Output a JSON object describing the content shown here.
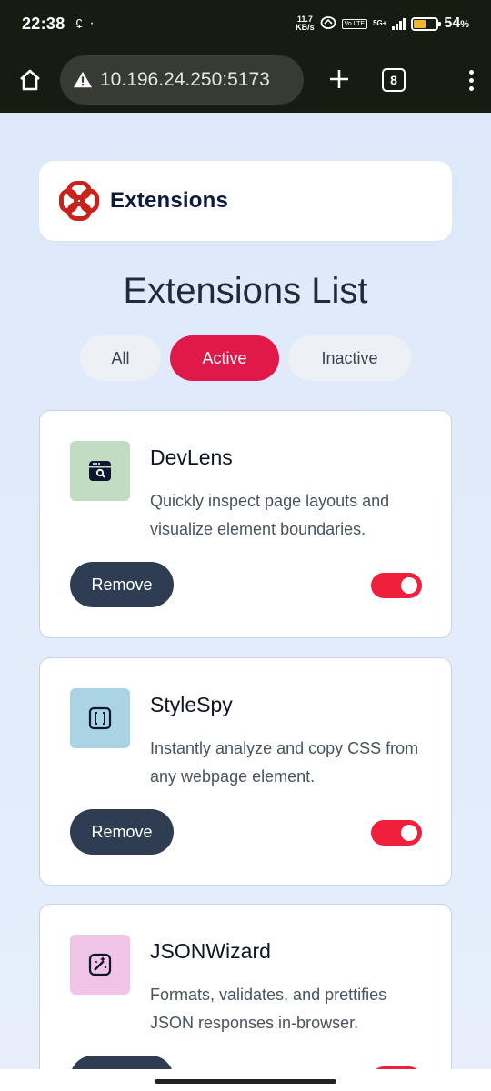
{
  "status_bar": {
    "time": "22:38",
    "net_speed_value": "11.7",
    "net_speed_unit": "KB/s",
    "network_type": "5G+",
    "volte_label": "Vo LTE",
    "battery_percent": "54",
    "battery_percent_suffix": "%",
    "battery_level": 0.54,
    "battery_color": "#f3b52c"
  },
  "browser": {
    "url": "10.196.24.250:5173",
    "tab_count": "8",
    "icons": [
      "home-icon",
      "warning-icon",
      "plus-icon",
      "tabs-icon",
      "more-vert-icon"
    ]
  },
  "header": {
    "brand": "Extensions",
    "logo_color": "#c7231c"
  },
  "page": {
    "title": "Extensions List"
  },
  "filters": [
    {
      "label": "All",
      "selected": false
    },
    {
      "label": "Active",
      "selected": true
    },
    {
      "label": "Inactive",
      "selected": false
    }
  ],
  "accent_color": "#e0194a",
  "extensions": [
    {
      "name": "DevLens",
      "description": "Quickly inspect page layouts and visualize element boundaries.",
      "icon": "devlens-icon",
      "icon_bg": "#c2dbc3",
      "remove_label": "Remove",
      "active": true
    },
    {
      "name": "StyleSpy",
      "description": "Instantly analyze and copy CSS from any webpage element.",
      "icon": "stylespy-icon",
      "icon_bg": "#a9d4e4",
      "remove_label": "Remove",
      "active": true
    },
    {
      "name": "JSONWizard",
      "description": "Formats, validates, and prettifies JSON responses in-browser.",
      "icon": "jsonwizard-icon",
      "icon_bg": "#efc4e7",
      "remove_label": "Remove",
      "active": true
    }
  ]
}
